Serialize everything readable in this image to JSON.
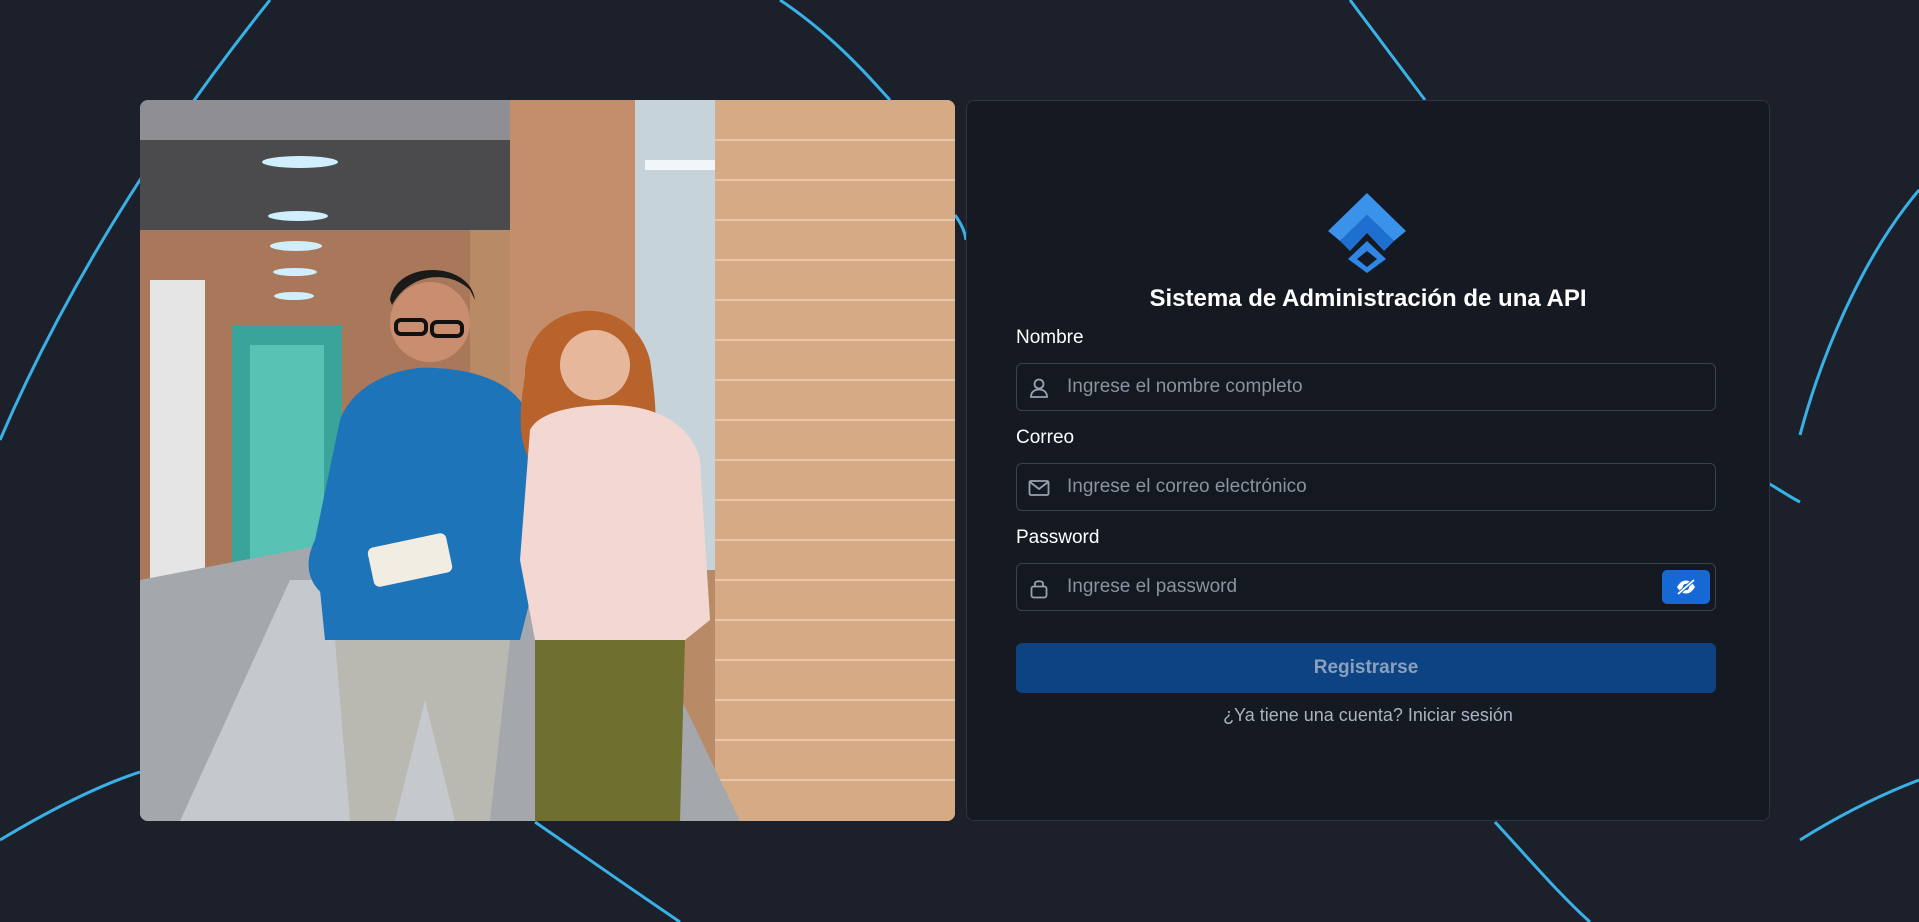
{
  "app": {
    "title": "Sistema de Administración de una API",
    "logo_icon": "stacked-chevron-logo-icon",
    "accent_color": "#1668d4",
    "background_color": "#1b202b",
    "line_color": "#3ab1e6"
  },
  "form": {
    "fields": [
      {
        "label": "Nombre",
        "placeholder": "Ingrese el nombre completo",
        "value": "",
        "icon": "user-icon",
        "type": "text"
      },
      {
        "label": "Correo",
        "placeholder": "Ingrese el correo electrónico",
        "value": "",
        "icon": "envelope-icon",
        "type": "email"
      },
      {
        "label": "Password",
        "placeholder": "Ingrese el password",
        "value": "",
        "icon": "lock-icon",
        "type": "password",
        "toggle_icon": "eye-slash-icon"
      }
    ],
    "submit_label": "Registrarse",
    "login_prompt": "¿Ya tiene una cuenta?",
    "login_link": "Iniciar sesión"
  },
  "image": {
    "subject": "photo-two-people-in-office-hallway"
  }
}
